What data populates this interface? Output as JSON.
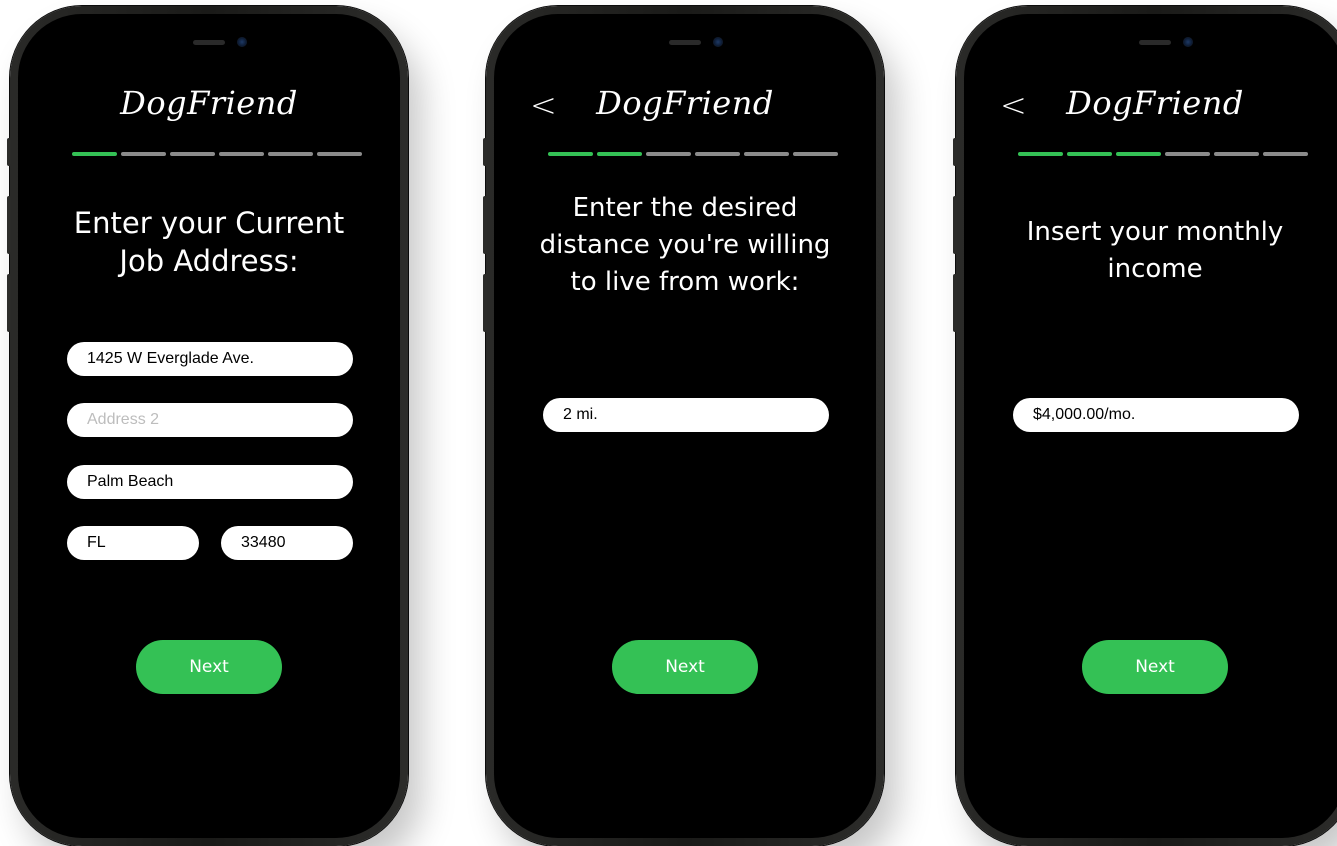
{
  "brand": {
    "logo_text": "DogFriend"
  },
  "colors": {
    "accent": "#34c155",
    "screen": "#000000",
    "field": "#ffffff",
    "progress_inactive": "#8b8b8b"
  },
  "icons": {
    "back": "chevron-left-icon"
  },
  "back_symbol": "<",
  "screens": [
    {
      "step": 1,
      "total_steps": 6,
      "heading": "Enter your Current\nJob Address:",
      "fields": {
        "address1": {
          "value": "1425 W Everglade Ave."
        },
        "address2": {
          "placeholder": "Address 2"
        },
        "city": {
          "value": "Palm Beach"
        },
        "state": {
          "value": "FL"
        },
        "zip": {
          "value": "33480"
        }
      },
      "next_label": "Next"
    },
    {
      "step": 2,
      "total_steps": 6,
      "heading": "Enter the desired\ndistance you're willing\nto live from work:",
      "fields": {
        "distance": {
          "value": "2 mi."
        }
      },
      "next_label": "Next"
    },
    {
      "step": 3,
      "total_steps": 6,
      "heading": "Insert your monthly\nincome",
      "fields": {
        "income": {
          "value": "$4,000.00/mo."
        }
      },
      "next_label": "Next"
    }
  ]
}
